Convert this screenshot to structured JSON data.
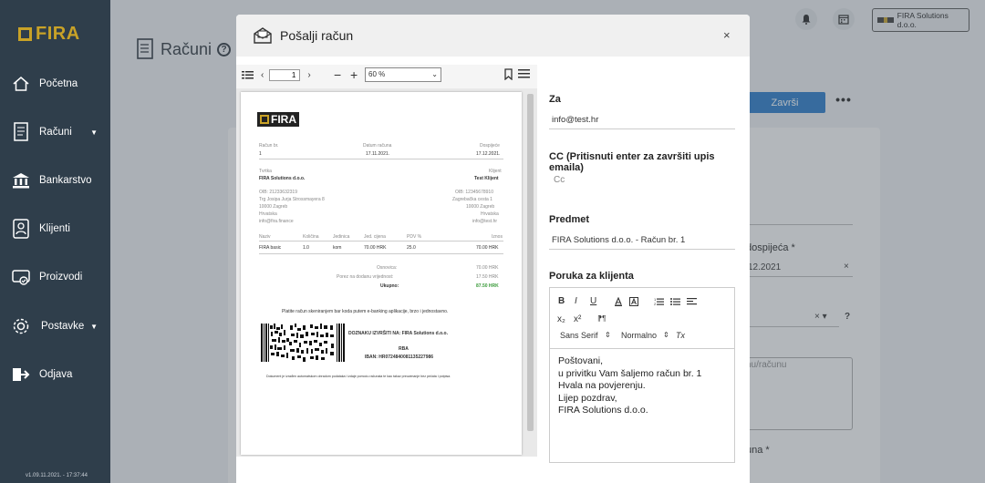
{
  "sidebar": {
    "logo_text": "FIRA",
    "items": [
      {
        "label": "Početna",
        "icon": "home-icon"
      },
      {
        "label": "Računi",
        "icon": "invoice-icon",
        "caret": "▼"
      },
      {
        "label": "Bankarstvo",
        "icon": "bank-icon"
      },
      {
        "label": "Klijenti",
        "icon": "client-icon"
      },
      {
        "label": "Proizvodi",
        "icon": "product-icon"
      },
      {
        "label": "Postavke",
        "icon": "gear-icon",
        "caret": "▼"
      },
      {
        "label": "Odjava",
        "icon": "logout-icon"
      }
    ],
    "version": "v1.09.11.2021. - 17:37:44"
  },
  "background": {
    "page_title": "Računi",
    "help": "?",
    "company": "FIRA Solutions d.o.o.",
    "zavrsi": "Završi",
    "more": "•••",
    "dospijeca_label": "dospijeća *",
    "dospijeca_value": "12.2021",
    "clear_x": "×",
    "help2": "?",
    "select_arrows": "× ▾",
    "textarea_ph": "nu/računu",
    "una_label": "una *"
  },
  "modal": {
    "title": "Pošalji račun",
    "close": "×"
  },
  "pdf": {
    "page": "1",
    "zoom": "60 %",
    "company_logo": "FIRA",
    "racun_label": "Račun br.",
    "racun_value": "1",
    "datum_label": "Datum računa",
    "datum_value": "17.11.2021.",
    "dospijece_label": "Dospijeće",
    "dospijece_value": "17.12.2021.",
    "tvrtka_label": "Tvrtka",
    "tvrtka_value": "FIRA Solutions d.o.o.",
    "klijent_label": "Klijent",
    "klijent_value": "Test Klijent",
    "seller": [
      "OIB: 21233632319",
      "Trg Josipa Jurja Strossmayera 8",
      "10000 Zagreb",
      "Hrvatska",
      "info@fira.finance"
    ],
    "buyer": [
      "OIB: 12345678910",
      "Zagrebačka cesta 1",
      "10000 Zagreb",
      "Hrvatska",
      "info@test.hr"
    ],
    "columns": [
      "Naziv",
      "Količina",
      "Jedinica",
      "Jed. cijena",
      "PDV %",
      "Iznos"
    ],
    "row": [
      "FIRA basic",
      "1.0",
      "kom",
      "70.00 HRK",
      "25.0",
      "70.00 HRK"
    ],
    "osnovica_label": "Osnovica:",
    "osnovica_value": "70.00 HRK",
    "porez_label": "Porez na dodanu vrijednost:",
    "porez_value": "17.50 HRK",
    "ukupno_label": "Ukupno:",
    "ukupno_value": "87.50 HRK",
    "pay_text": "Platite račun skeniranjem bar koda putem e-banking aplikacije, brzo i jednostavno.",
    "doznaku": "DOZNAKU IZVRŠITI NA: FIRA Solutions d.o.o.",
    "rba": "RBA",
    "iban": "IBAN: HR0724840081135227986",
    "footer": "Dokument je izrađen automatskom obradom podataka i izdaje pomoću računala te kao takav preuzimanje bez pečata i potpisa."
  },
  "form": {
    "za_label": "Za",
    "za_value": "info@test.hr",
    "cc_label": "CC (Pritisnuti enter za završiti upis emaila)",
    "cc_placeholder": "Cc",
    "predmet_label": "Predmet",
    "predmet_value": "FIRA Solutions d.o.o. - Račun br. 1",
    "poruka_label": "Poruka za klijenta",
    "toolbar": {
      "bold": "B",
      "italic": "I",
      "underline": "U",
      "sub": "x₂",
      "sup": "x²",
      "rtl": "⁋¶",
      "font": "Sans Serif",
      "size": "Normalno",
      "updown": "⇕",
      "clear": "Tx"
    },
    "message": [
      "Poštovani,",
      "u privitku Vam šaljemo račun br. 1",
      "Hvala na povjerenju.",
      "Lijep pozdrav,",
      "FIRA Solutions d.o.o."
    ]
  }
}
